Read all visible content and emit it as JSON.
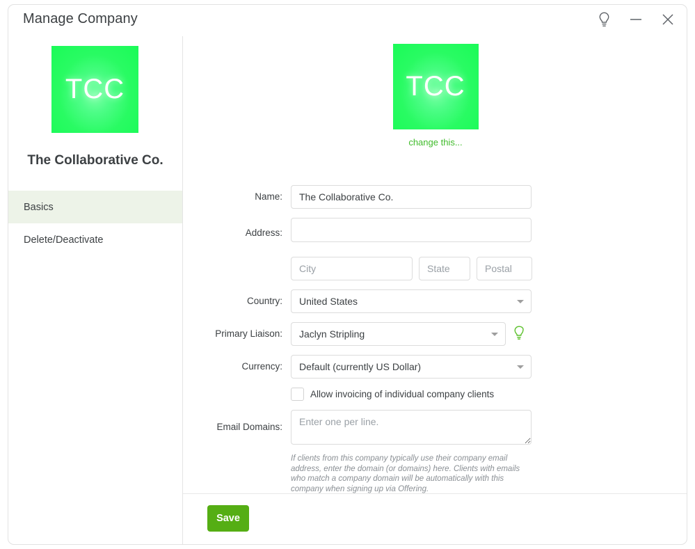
{
  "window": {
    "title": "Manage Company",
    "controls": [
      {
        "name": "lightbulb-icon",
        "label": "Tips"
      },
      {
        "name": "minimize-icon",
        "label": "Minimize"
      },
      {
        "name": "close-icon",
        "label": "Close"
      }
    ]
  },
  "colors": {
    "accent_green": "#3fbb2a",
    "save_green": "#55ae14",
    "logo_green": "#1afb57",
    "active_nav_bg": "#edf3e8",
    "text": "#3c4043",
    "placeholder": "#9aa0a6",
    "border": "#dcdcdc"
  },
  "sidebar": {
    "logo_initials": "TCC",
    "company_name": "The Collaborative Co.",
    "items": [
      {
        "label": "Basics",
        "active": true
      },
      {
        "label": "Delete/Deactivate",
        "active": false
      }
    ]
  },
  "main": {
    "logo_initials": "TCC",
    "change_logo_link": "change this...",
    "form": {
      "name": {
        "label": "Name:",
        "value": "The Collaborative Co.",
        "placeholder": ""
      },
      "address": {
        "label": "Address:",
        "value": "",
        "placeholder": ""
      },
      "city": {
        "value": "",
        "placeholder": "City"
      },
      "state": {
        "value": "",
        "placeholder": "State"
      },
      "postal": {
        "value": "",
        "placeholder": "Postal"
      },
      "country": {
        "label": "Country:",
        "value": "United States",
        "options": [
          "United States"
        ]
      },
      "primary_liaison": {
        "label": "Primary Liaison:",
        "value": "Jaclyn Stripling",
        "options": [
          "Jaclyn Stripling"
        ],
        "hint_icon": "lightbulb-icon"
      },
      "currency": {
        "label": "Currency:",
        "value": "Default (currently US Dollar)",
        "options": [
          "Default (currently US Dollar)"
        ]
      },
      "allow_invoicing": {
        "label": "Allow invoicing of individual company clients",
        "checked": false
      },
      "email_domains": {
        "label": "Email Domains:",
        "value": "",
        "placeholder": "Enter one per line.",
        "help": "If clients from this company typically use their company email address, enter the domain (or domains) here. Clients with emails who match a company domain will be automatically with this company when signing up via Offering."
      }
    }
  },
  "footer": {
    "save_label": "Save"
  }
}
